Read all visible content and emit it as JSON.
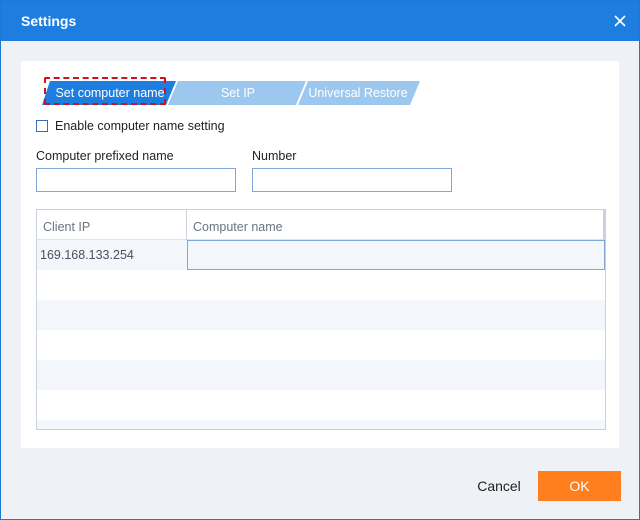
{
  "window": {
    "title": "Settings"
  },
  "tabs": [
    {
      "label": "Set computer name",
      "active": true
    },
    {
      "label": "Set IP",
      "active": false
    },
    {
      "label": "Universal Restore",
      "active": false
    }
  ],
  "options": {
    "enable_label": "Enable computer name setting",
    "enable_checked": false
  },
  "fields": {
    "prefix_label": "Computer prefixed name",
    "prefix_value": "",
    "number_label": "Number",
    "number_value": ""
  },
  "grid": {
    "columns": [
      "Client IP",
      "Computer name"
    ],
    "rows": [
      {
        "client_ip": "169.168.133.254",
        "computer_name": ""
      }
    ]
  },
  "buttons": {
    "cancel": "Cancel",
    "ok": "OK"
  },
  "colors": {
    "titlebar": "#1e7ee0",
    "tab_active": "#1e7ee0",
    "tab_inactive": "#9cc8f0",
    "ok_button": "#ff7f1f",
    "focus_outline": "#d0101a"
  },
  "icons": {
    "close": "close-icon"
  }
}
